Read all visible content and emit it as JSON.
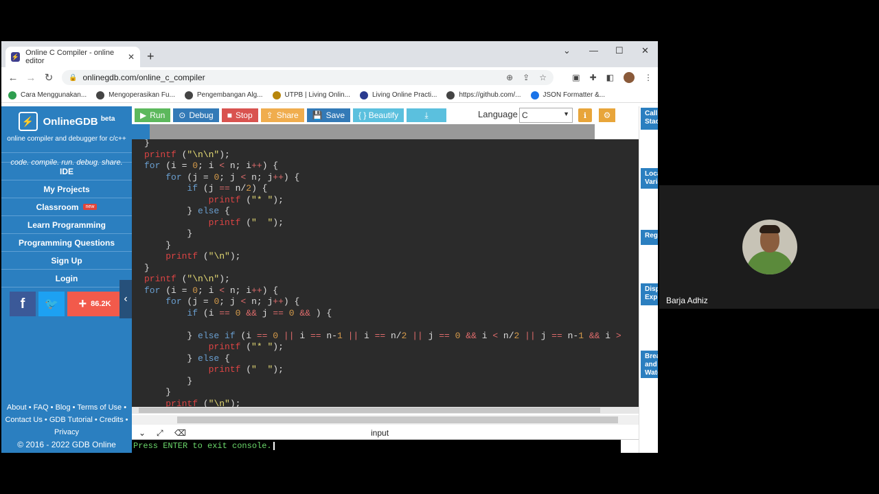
{
  "browser": {
    "tab_title": "Online C Compiler - online editor",
    "url": "onlinegdb.com/online_c_compiler",
    "bookmarks": [
      "Cara Menggunakan...",
      "Mengoperasikan Fu...",
      "Pengembangan Alg...",
      "UTPB | Living Onlin...",
      "Living Online Practi...",
      "https://github.com/...",
      "JSON Formatter &..."
    ],
    "bookmark_colors": [
      "#2e9e4f",
      "#444444",
      "#444444",
      "#b8860b",
      "#2a3b8f",
      "#444444",
      "#1a73e8"
    ]
  },
  "sidebar": {
    "brand": "OnlineGDB",
    "beta": "beta",
    "tagline": "online compiler and debugger for c/c++",
    "motto": "code. compile. run. debug. share.",
    "nav": [
      "IDE",
      "My Projects",
      "Classroom",
      "Learn Programming",
      "Programming Questions",
      "Sign Up",
      "Login"
    ],
    "new_badge": "new",
    "share_count": "86.2K",
    "footer_line1": "About • FAQ • Blog • Terms of Use •",
    "footer_line2": "Contact Us • GDB Tutorial • Credits •",
    "footer_line3": "Privacy",
    "copyright": "© 2016 - 2022 GDB Online"
  },
  "toolbar": {
    "run": "Run",
    "debug": "Debug",
    "stop": "Stop",
    "share": "Share",
    "save": "Save",
    "beautify": "{ } Beautify",
    "language_label": "Language",
    "language_value": "C",
    "colors": {
      "run": "#5cb85c",
      "debug": "#337ab7",
      "stop": "#d9534f",
      "share": "#f0ad4e",
      "save": "#337ab7",
      "beautify": "#5bc0de",
      "download": "#5bc0de"
    }
  },
  "code_lines": [
    "}",
    "printf (\"\\n\\n\");",
    "for (i = 0; i < n; i++) {",
    "    for (j = 0; j < n; j++) {",
    "        if (j == n/2) {",
    "            printf (\"* \");",
    "        } else {",
    "            printf (\"  \");",
    "        }",
    "    }",
    "    printf (\"\\n\");",
    "}",
    "printf (\"\\n\\n\");",
    "for (i = 0; i < n; i++) {",
    "    for (j = 0; j < n; j++) {",
    "        if (i == 0 && j == 0 && ) {",
    "",
    "        } else if (i == 0 || i == n-1 || i == n/2 || j == 0 && i < n/2 || j == n-1 && i >",
    "            printf (\"* \");",
    "        } else {",
    "            printf (\"  \");",
    "        }",
    "    }",
    "    printf (\"\\n\");"
  ],
  "console": {
    "input_label": "input",
    "output": "Press ENTER to exit console."
  },
  "right_panel": [
    "Call Stack",
    "Local Variables",
    "Registers",
    "Display Expressions",
    "Breakpoints and Watchpoints"
  ],
  "participant": {
    "name": "Barja Adhiz"
  }
}
